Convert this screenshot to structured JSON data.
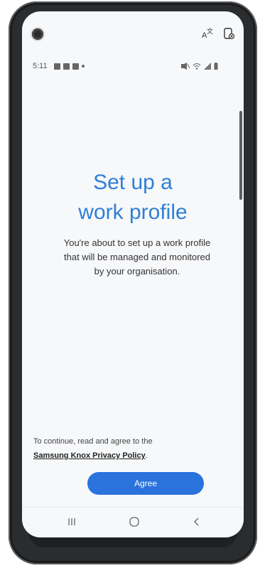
{
  "status_bar": {
    "time": "5:11"
  },
  "setup": {
    "title": "Set up a\nwork profile",
    "description": "You're about to set up a work profile that will be managed and monitored by your organisation."
  },
  "consent": {
    "prefix": "To continue, read and agree to the",
    "link": "Samsung Knox Privacy Policy",
    "suffix": "."
  },
  "actions": {
    "agree_label": "Agree"
  },
  "colors": {
    "accent": "#2f7fd8",
    "button": "#2a72dc",
    "background": "#f7f8fa"
  },
  "icons": [
    "translate-icon",
    "screen-off-icon",
    "recents-icon",
    "home-icon",
    "back-icon"
  ]
}
